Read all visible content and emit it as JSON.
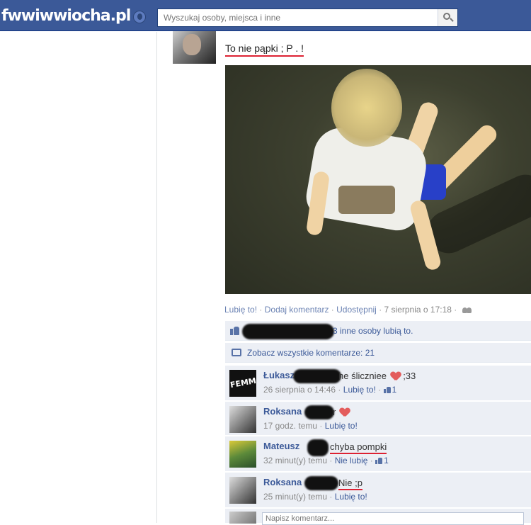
{
  "header": {
    "logo_text": "fwwiwwiocha.pl",
    "search_placeholder": "Wyszukaj osoby, miejsca i inne"
  },
  "post": {
    "text": "To nie pąpki ; P . !",
    "actions": {
      "like": "Lubię to!",
      "comment": "Dodaj komentarz",
      "share": "Udostępnij",
      "date": "7 sierpnia o 17:18"
    }
  },
  "likes": {
    "text": "3 inne osoby lubią to.",
    "suffix": "lubią to."
  },
  "view_comments": "Zobacz wszystkie komentarze: 21",
  "comments": [
    {
      "name": "Łukasz",
      "body": "he śliczniee",
      "emoji_suffix": ";33",
      "time": "26 sierpnia o 14:46",
      "action": "Lubię to!",
      "likes": "1"
    },
    {
      "name": "Roksana",
      "body": "r",
      "time": "17 godz. temu",
      "action": "Lubię to!"
    },
    {
      "name": "Mateusz",
      "body": "chyba pompki",
      "time": "32 minut(y) temu",
      "action": "Nie lubię",
      "likes": "1"
    },
    {
      "name": "Roksana",
      "body": "Nie ;p",
      "time": "25 minut(y) temu",
      "action": "Lubię to!"
    }
  ],
  "reply": {
    "placeholder": "Napisz komentarz..."
  },
  "colors": {
    "topbar": "#3b5998",
    "link": "#3b5998",
    "feed_bg": "#eceff5",
    "annotation_red": "#dd2233"
  }
}
